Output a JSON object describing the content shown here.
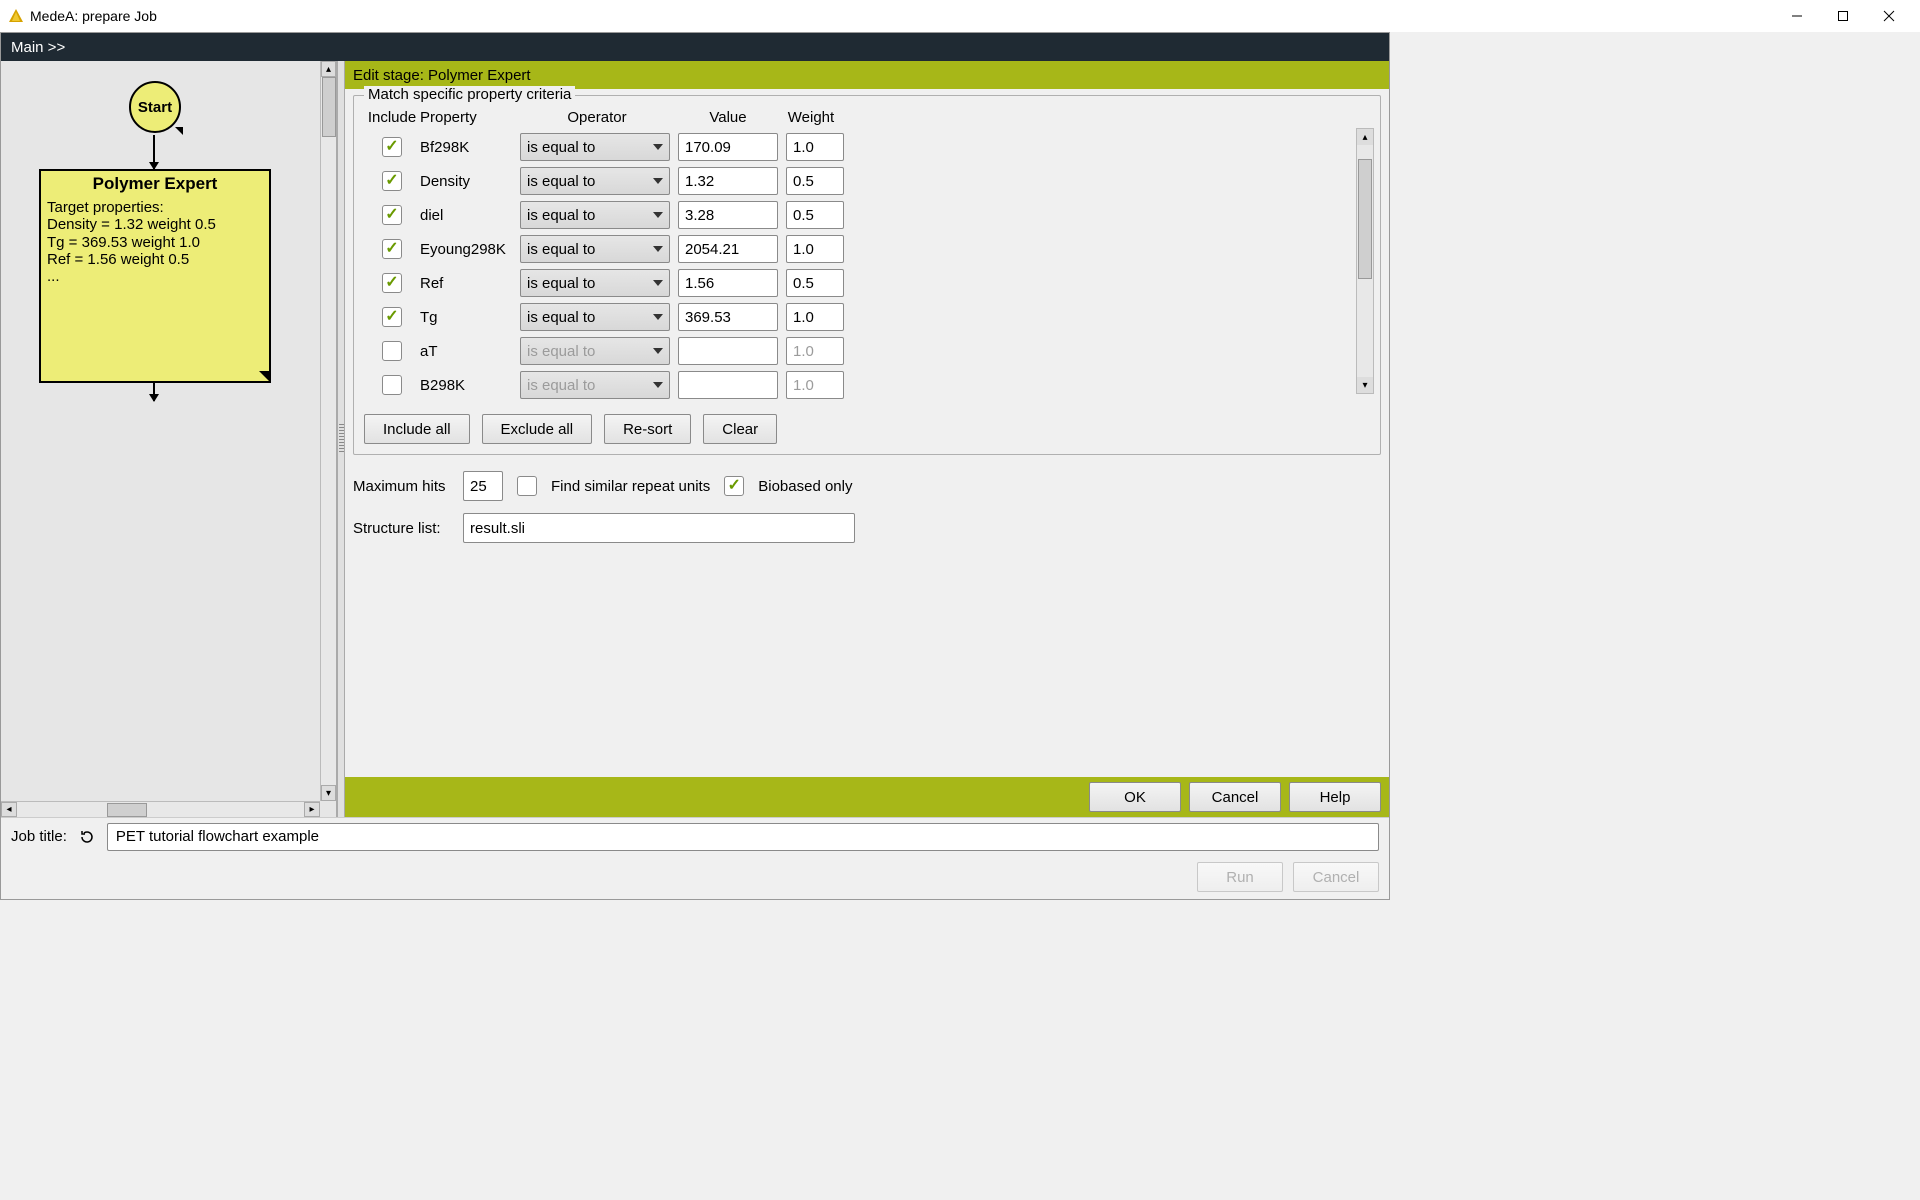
{
  "window": {
    "title": "MedeA: prepare Job"
  },
  "topbar": {
    "breadcrumb": "Main >>"
  },
  "flow": {
    "start_label": "Start",
    "stage_title": "Polymer Expert",
    "stage_lines": {
      "l0": "Target properties:",
      "l1": "Density = 1.32 weight 0.5",
      "l2": "Tg = 369.53 weight 1.0",
      "l3": "Ref = 1.56 weight 0.5",
      "l4": "..."
    }
  },
  "stage_header": "Edit stage: Polymer Expert",
  "criteria": {
    "legend": "Match specific property criteria",
    "headers": {
      "include": "Include",
      "property": "Property",
      "operator": "Operator",
      "value": "Value",
      "weight": "Weight"
    },
    "rows": [
      {
        "checked": true,
        "property": "Bf298K",
        "operator": "is equal to",
        "value": "170.09",
        "weight": "1.0"
      },
      {
        "checked": true,
        "property": "Density",
        "operator": "is equal to",
        "value": "1.32",
        "weight": "0.5"
      },
      {
        "checked": true,
        "property": "diel",
        "operator": "is equal to",
        "value": "3.28",
        "weight": "0.5"
      },
      {
        "checked": true,
        "property": "Eyoung298K",
        "operator": "is equal to",
        "value": "2054.21",
        "weight": "1.0"
      },
      {
        "checked": true,
        "property": "Ref",
        "operator": "is equal to",
        "value": "1.56",
        "weight": "0.5"
      },
      {
        "checked": true,
        "property": "Tg",
        "operator": "is equal to",
        "value": "369.53",
        "weight": "1.0"
      },
      {
        "checked": false,
        "property": "aT",
        "operator": "is equal to",
        "value": "",
        "weight": "1.0"
      },
      {
        "checked": false,
        "property": "B298K",
        "operator": "is equal to",
        "value": "",
        "weight": "1.0"
      }
    ],
    "buttons": {
      "include_all": "Include all",
      "exclude_all": "Exclude all",
      "resort": "Re-sort",
      "clear": "Clear"
    }
  },
  "options": {
    "max_hits_label": "Maximum hits",
    "max_hits_value": "25",
    "find_similar_label": "Find similar repeat units",
    "find_similar_checked": false,
    "biobased_label": "Biobased only",
    "biobased_checked": true,
    "structure_list_label": "Structure list:",
    "structure_list_value": "result.sli"
  },
  "bottombar": {
    "ok": "OK",
    "cancel": "Cancel",
    "help": "Help"
  },
  "jobbar": {
    "label": "Job title:",
    "value": "PET tutorial flowchart example"
  },
  "footer": {
    "run": "Run",
    "cancel": "Cancel"
  }
}
